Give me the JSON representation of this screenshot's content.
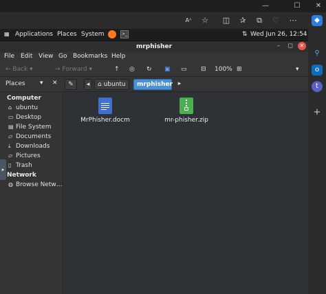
{
  "window_controls": {
    "minimize": "—",
    "maximize": "☐",
    "close": "✕"
  },
  "panel": {
    "applications": "Applications",
    "places": "Places",
    "system": "System",
    "datetime": "Wed Jun 26, 12:54"
  },
  "window": {
    "title": "mrphisher"
  },
  "menubar": [
    "File",
    "Edit",
    "View",
    "Go",
    "Bookmarks",
    "Help"
  ],
  "toolbar": {
    "back": "Back",
    "forward": "Forward",
    "zoom": "100%"
  },
  "location": {
    "places_label": "Places",
    "crumbs": [
      "ubuntu",
      "mrphisher"
    ]
  },
  "sidebar": {
    "computer_header": "Computer",
    "computer_items": [
      {
        "label": "ubuntu",
        "icon": "home-icon"
      },
      {
        "label": "Desktop",
        "icon": "desktop-icon"
      },
      {
        "label": "File System",
        "icon": "drive-icon"
      },
      {
        "label": "Documents",
        "icon": "folder-icon"
      },
      {
        "label": "Downloads",
        "icon": "download-icon"
      },
      {
        "label": "Pictures",
        "icon": "folder-icon"
      },
      {
        "label": "Trash",
        "icon": "trash-icon"
      }
    ],
    "network_header": "Network",
    "network_items": [
      {
        "label": "Browse Netw…",
        "icon": "network-icon"
      }
    ]
  },
  "files": [
    {
      "name": "MrPhisher.docm",
      "icon": "document-icon",
      "color": "#3f6fd1"
    },
    {
      "name": "mr-phisher.zip",
      "icon": "zip-archive-icon",
      "color": "#4caf50"
    }
  ],
  "colors": {
    "accent": "#4a90d9",
    "close": "#e8564a"
  }
}
